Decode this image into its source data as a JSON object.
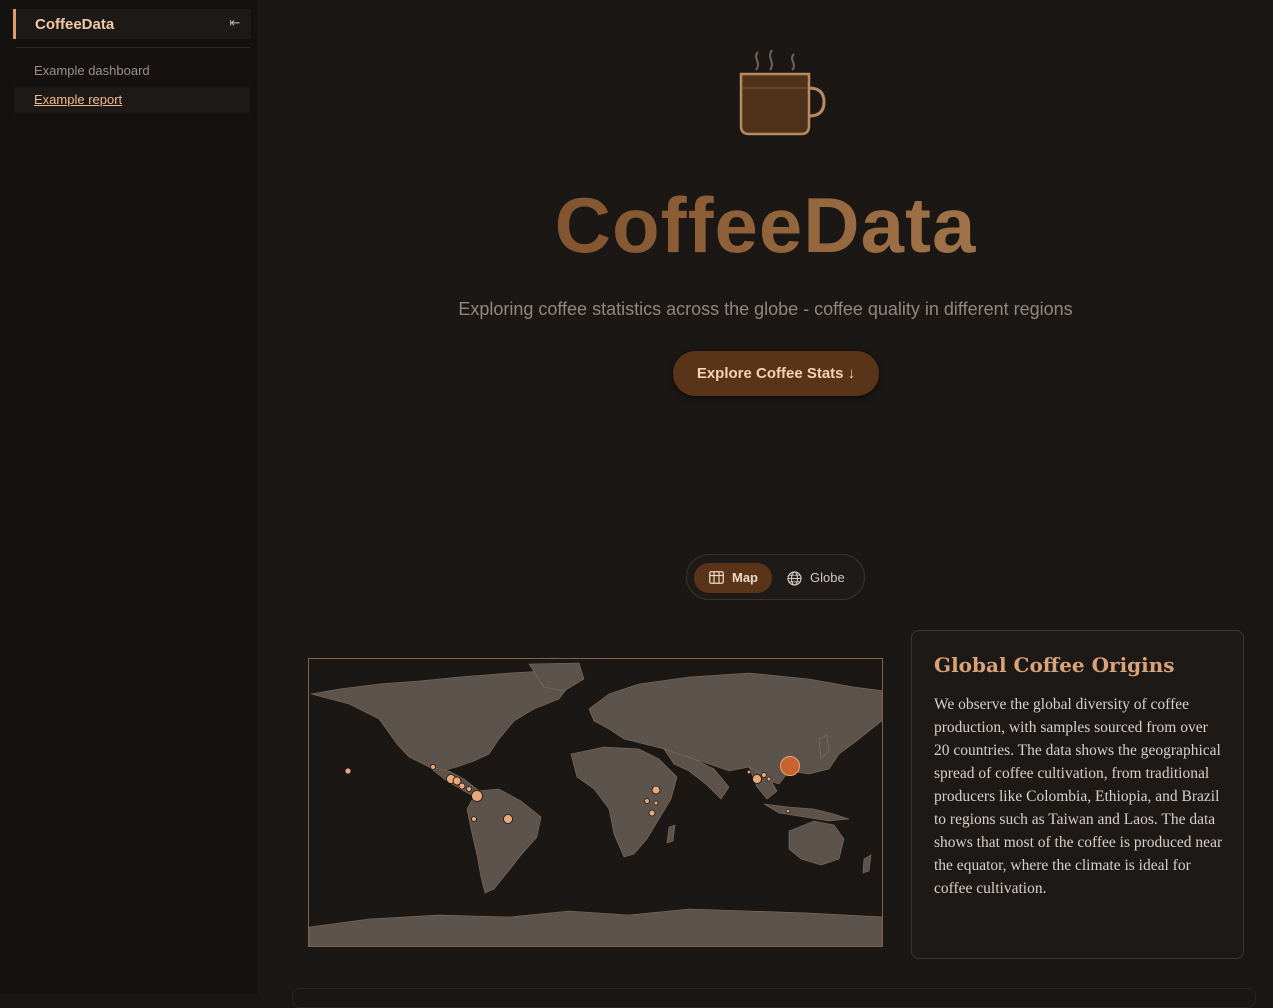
{
  "sidebar": {
    "title": "CoffeeData",
    "collapse_icon": "collapse-left-icon",
    "links": [
      {
        "label": "Example dashboard"
      },
      {
        "label": "Example report"
      }
    ]
  },
  "hero": {
    "title": "CoffeeData",
    "subtitle": "Exploring coffee statistics across the globe - coffee quality in different regions",
    "cta_label": "Explore Coffee Stats ↓",
    "icon": "coffee-mug-icon"
  },
  "view_toggle": {
    "selected": "Map",
    "options": [
      {
        "label": "Map",
        "icon": "map-grid-icon"
      },
      {
        "label": "Globe",
        "icon": "globe-icon"
      }
    ]
  },
  "info_card": {
    "title": "Global Coffee Origins",
    "body": "We observe the global diversity of coffee production, with samples sourced from over 20 countries. The data shows the geographical spread of coffee cultivation, from traditional producers like Colombia, Ethiopia, and Brazil to regions such as Taiwan and Laos. The data shows that most of the coffee is produced near the equator, where the climate is ideal for coffee cultivation."
  },
  "colors": {
    "accent": "#e39a6a",
    "button": "#5a3419",
    "land": "#5b534c",
    "marker": "#e8a878",
    "marker_highlight": "#c8622e"
  }
}
